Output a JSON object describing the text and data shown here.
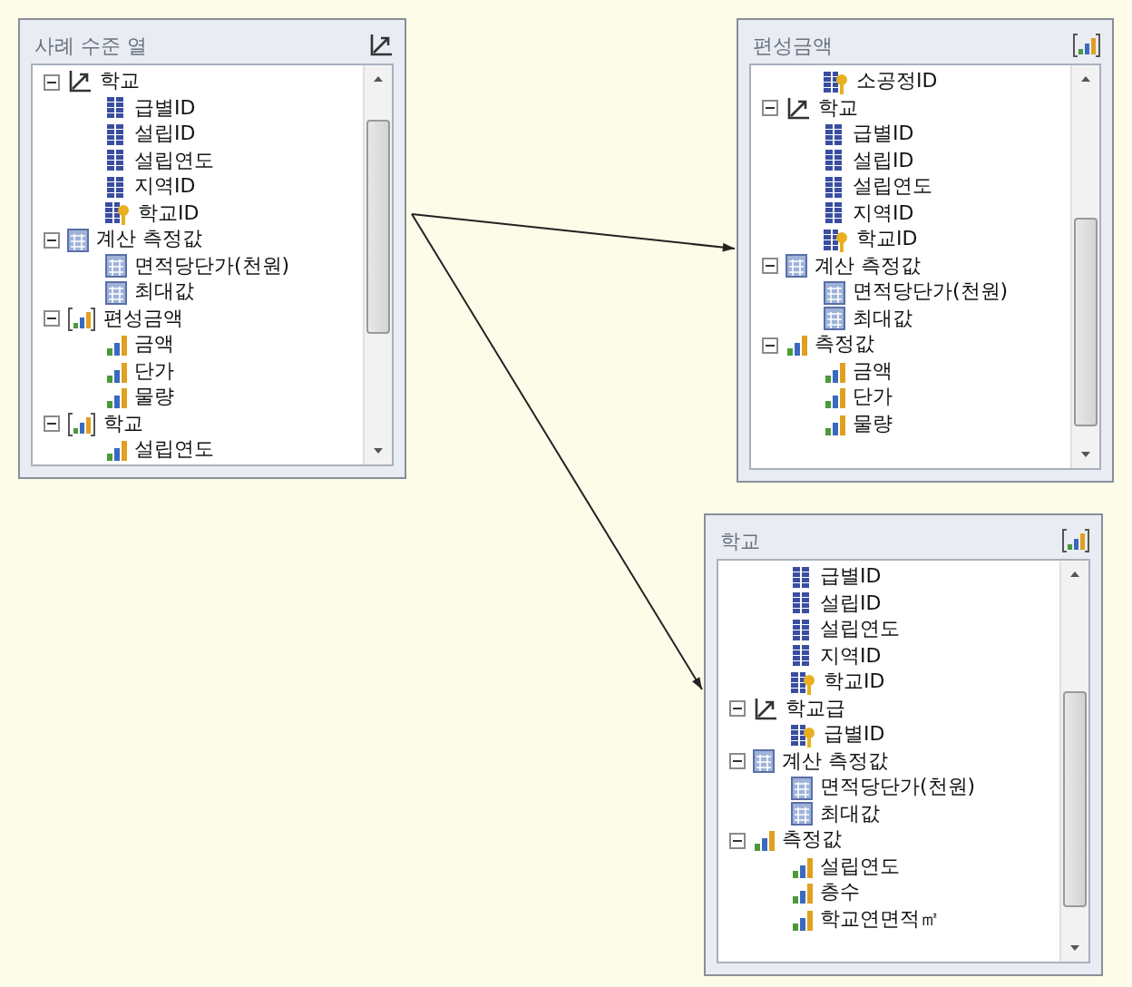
{
  "panels": [
    {
      "title": "사례 수준 열",
      "kind": "dimension",
      "items": [
        {
          "label": "학교",
          "kind": "dimension",
          "expanded": true,
          "children": [
            {
              "label": "급별ID",
              "kind": "attribute"
            },
            {
              "label": "설립ID",
              "kind": "attribute"
            },
            {
              "label": "설립연도",
              "kind": "attribute"
            },
            {
              "label": "지역ID",
              "kind": "attribute"
            },
            {
              "label": "학교ID",
              "kind": "key"
            }
          ]
        },
        {
          "label": "계산 측정값",
          "kind": "calc",
          "expanded": true,
          "children": [
            {
              "label": "면적당단가(천원)",
              "kind": "calc"
            },
            {
              "label": "최대값",
              "kind": "calc"
            }
          ]
        },
        {
          "label": "편성금액",
          "kind": "measure-group",
          "expanded": true,
          "children": [
            {
              "label": "금액",
              "kind": "measure"
            },
            {
              "label": "단가",
              "kind": "measure"
            },
            {
              "label": "물량",
              "kind": "measure"
            }
          ]
        },
        {
          "label": "학교",
          "kind": "measure-group",
          "expanded": true,
          "children": [
            {
              "label": "설립연도",
              "kind": "measure"
            }
          ]
        }
      ]
    },
    {
      "title": "편성금액",
      "kind": "measure-group",
      "items": [
        {
          "children": [
            {
              "label": "소공정ID",
              "kind": "key"
            }
          ]
        },
        {
          "label": "학교",
          "kind": "dimension",
          "expanded": true,
          "children": [
            {
              "label": "급별ID",
              "kind": "attribute"
            },
            {
              "label": "설립ID",
              "kind": "attribute"
            },
            {
              "label": "설립연도",
              "kind": "attribute"
            },
            {
              "label": "지역ID",
              "kind": "attribute"
            },
            {
              "label": "학교ID",
              "kind": "key"
            }
          ]
        },
        {
          "label": "계산 측정값",
          "kind": "calc",
          "expanded": true,
          "children": [
            {
              "label": "면적당단가(천원)",
              "kind": "calc"
            },
            {
              "label": "최대값",
              "kind": "calc"
            }
          ]
        },
        {
          "label": "측정값",
          "kind": "measure",
          "expanded": true,
          "children": [
            {
              "label": "금액",
              "kind": "measure"
            },
            {
              "label": "단가",
              "kind": "measure"
            },
            {
              "label": "물량",
              "kind": "measure"
            }
          ]
        }
      ]
    },
    {
      "title": "학교",
      "kind": "measure-group",
      "items": [
        {
          "children": [
            {
              "label": "급별ID",
              "kind": "attribute"
            },
            {
              "label": "설립ID",
              "kind": "attribute"
            },
            {
              "label": "설립연도",
              "kind": "attribute"
            },
            {
              "label": "지역ID",
              "kind": "attribute"
            },
            {
              "label": "학교ID",
              "kind": "key"
            }
          ]
        },
        {
          "label": "학교급",
          "kind": "dimension",
          "expanded": true,
          "children": [
            {
              "label": "급별ID",
              "kind": "key"
            }
          ]
        },
        {
          "label": "계산 측정값",
          "kind": "calc",
          "expanded": true,
          "children": [
            {
              "label": "면적당단가(천원)",
              "kind": "calc"
            },
            {
              "label": "최대값",
              "kind": "calc"
            }
          ]
        },
        {
          "label": "측정값",
          "kind": "measure",
          "expanded": true,
          "children": [
            {
              "label": "설립연도",
              "kind": "measure"
            },
            {
              "label": "층수",
              "kind": "measure"
            },
            {
              "label": "학교연면적㎡",
              "kind": "measure"
            }
          ]
        }
      ]
    }
  ]
}
